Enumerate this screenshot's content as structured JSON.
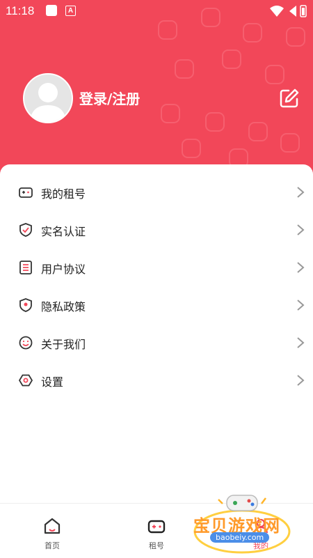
{
  "status_bar": {
    "time": "11:18",
    "indicator_letter": "A"
  },
  "colors": {
    "accent": "#f24759",
    "text": "#222222",
    "icon": "#333333",
    "chevron": "#999999"
  },
  "profile": {
    "login_label": "登录/注册",
    "avatar_icon": "user-avatar-icon",
    "edit_icon": "edit-icon"
  },
  "menu": {
    "items": [
      {
        "label": "我的租号",
        "icon": "gamepad-icon"
      },
      {
        "label": "实名认证",
        "icon": "shield-check-icon"
      },
      {
        "label": "用户协议",
        "icon": "document-list-icon"
      },
      {
        "label": "隐私政策",
        "icon": "location-shield-icon"
      },
      {
        "label": "关于我们",
        "icon": "smiley-icon"
      },
      {
        "label": "设置",
        "icon": "gear-icon"
      }
    ]
  },
  "tabbar": {
    "tabs": [
      {
        "label": "首页",
        "icon": "home-icon"
      },
      {
        "label": "租号",
        "icon": "gamepad-icon"
      },
      {
        "label": "我的",
        "icon": "user-icon"
      }
    ]
  },
  "watermark": {
    "title": "宝贝游戏网",
    "url": "baobeiy.com"
  }
}
